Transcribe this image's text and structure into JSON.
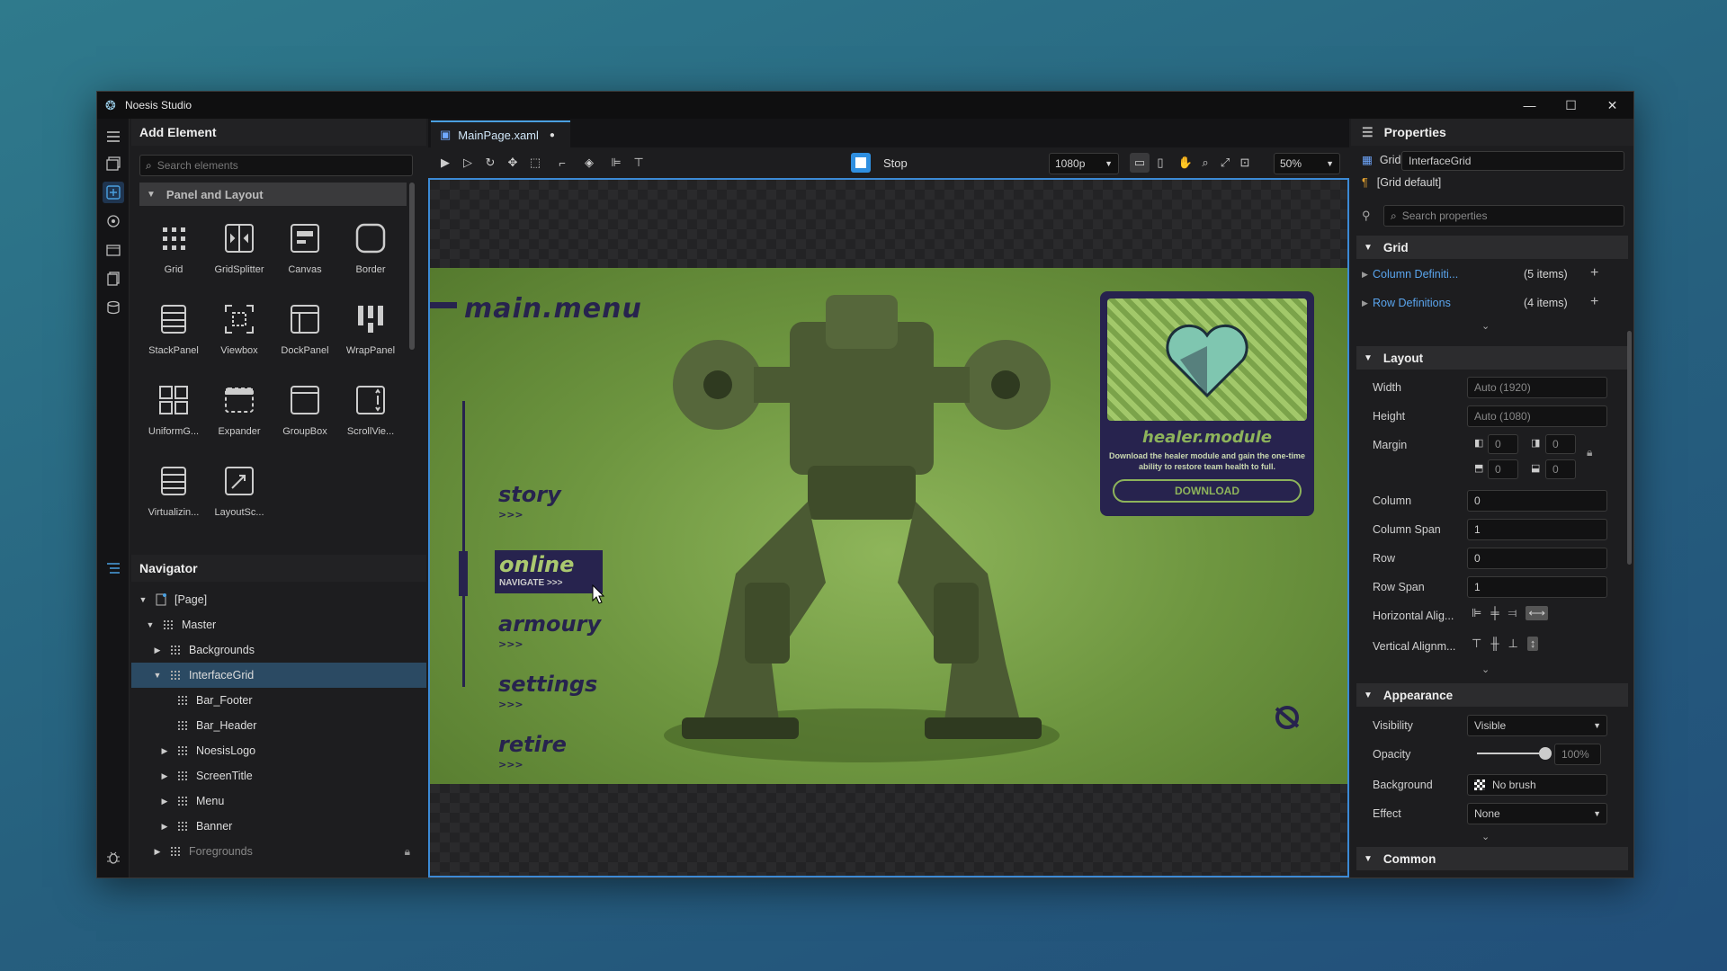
{
  "window": {
    "title": "Noesis Studio"
  },
  "left_panel": {
    "header": "Add Element",
    "search_placeholder": "Search elements",
    "category": "Panel and Layout",
    "elements": [
      {
        "label": "Grid",
        "icon": "grid-icon"
      },
      {
        "label": "GridSplitter",
        "icon": "gridsplitter-icon"
      },
      {
        "label": "Canvas",
        "icon": "canvas-icon"
      },
      {
        "label": "Border",
        "icon": "border-icon"
      },
      {
        "label": "StackPanel",
        "icon": "stackpanel-icon"
      },
      {
        "label": "Viewbox",
        "icon": "viewbox-icon"
      },
      {
        "label": "DockPanel",
        "icon": "dockpanel-icon"
      },
      {
        "label": "WrapPanel",
        "icon": "wrappanel-icon"
      },
      {
        "label": "UniformG...",
        "icon": "uniformgrid-icon"
      },
      {
        "label": "Expander",
        "icon": "expander-icon"
      },
      {
        "label": "GroupBox",
        "icon": "groupbox-icon"
      },
      {
        "label": "ScrollVie...",
        "icon": "scrollviewer-icon"
      },
      {
        "label": "Virtualizin...",
        "icon": "virtualizingpanel-icon"
      },
      {
        "label": "LayoutSc...",
        "icon": "layoutscale-icon"
      }
    ]
  },
  "navigator": {
    "header": "Navigator",
    "items": [
      {
        "label": "[Page]",
        "expanded": true
      },
      {
        "label": "Master",
        "expanded": true
      },
      {
        "label": "Backgrounds",
        "expanded": false
      },
      {
        "label": "InterfaceGrid",
        "expanded": true,
        "selected": true
      },
      {
        "label": "Bar_Footer"
      },
      {
        "label": "Bar_Header"
      },
      {
        "label": "NoesisLogo",
        "expanded": false
      },
      {
        "label": "ScreenTitle",
        "expanded": false
      },
      {
        "label": "Menu",
        "expanded": false
      },
      {
        "label": "Banner",
        "expanded": false
      },
      {
        "label": "Foregrounds",
        "expanded": false,
        "locked": true
      }
    ]
  },
  "editor": {
    "tab_label": "MainPage.xaml",
    "stop_label": "Stop",
    "resolution": "1080p",
    "zoom": "50%"
  },
  "scene": {
    "title": "main.menu",
    "menu": [
      "story",
      "online",
      "armoury",
      "settings",
      "retire"
    ],
    "menu_arrows": ">>>",
    "online_sub": "NAVIGATE >>>",
    "card_title": "healer.module",
    "card_desc": "Download the healer module and gain the one-time ability to restore team health to full.",
    "card_button": "DOWNLOAD"
  },
  "properties": {
    "header": "Properties",
    "type_label": "Grid",
    "name_value": "InterfaceGrid",
    "style_value": "[Grid default]",
    "search_placeholder": "Search properties",
    "grid_section": "Grid",
    "column_definitions": {
      "label": "Column Definiti...",
      "count": "(5 items)"
    },
    "row_definitions": {
      "label": "Row Definitions",
      "count": "(4 items)"
    },
    "layout_section": "Layout",
    "width": {
      "label": "Width",
      "value": "Auto (1920)"
    },
    "height": {
      "label": "Height",
      "value": "Auto (1080)"
    },
    "margin": {
      "label": "Margin",
      "left": "0",
      "right": "0",
      "top": "0",
      "bottom": "0"
    },
    "column": {
      "label": "Column",
      "value": "0"
    },
    "column_span": {
      "label": "Column Span",
      "value": "1"
    },
    "row": {
      "label": "Row",
      "value": "0"
    },
    "row_span": {
      "label": "Row Span",
      "value": "1"
    },
    "h_align": {
      "label": "Horizontal Alig..."
    },
    "v_align": {
      "label": "Vertical Alignm..."
    },
    "appearance_section": "Appearance",
    "visibility": {
      "label": "Visibility",
      "value": "Visible"
    },
    "opacity": {
      "label": "Opacity",
      "value": "100%",
      "level": 1.0
    },
    "background": {
      "label": "Background",
      "value": "No brush"
    },
    "effect": {
      "label": "Effect",
      "value": "None"
    },
    "common_section": "Common"
  },
  "colors": {
    "accent": "#3b8ad6",
    "scene_ink": "#27234e",
    "scene_green": "#7ba34a"
  }
}
